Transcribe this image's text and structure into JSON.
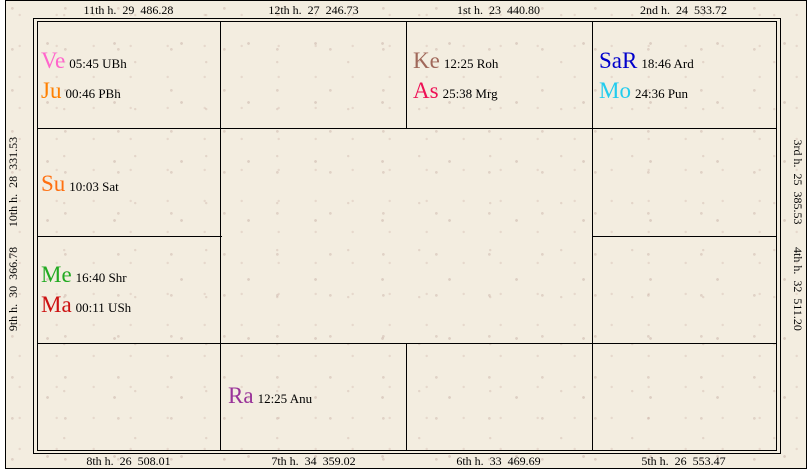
{
  "colors": {
    "Ve": "#ff66cc",
    "Ju": "#ff8000",
    "Ke": "#a0685a",
    "As": "#ee1155",
    "SaR": "#0000cc",
    "Mo": "#22ccee",
    "Su": "#ff7010",
    "Me": "#22aa22",
    "Ma": "#cc1111",
    "Ra": "#993399"
  },
  "houses": {
    "h11": "11th h.  29  486.28",
    "h12": "12th h.  27  246.73",
    "h1": "1st h.  23  440.80",
    "h2": "2nd h.  24  533.72",
    "h10": "10th h.  28  331.53",
    "h9": "9th h.  30  366.78",
    "h3": "3rd h.  25  385.53",
    "h4": "4th h.  32  511.20",
    "h8": "8th h.  26  508.01",
    "h7": "7th h.  34  359.02",
    "h6": "6th h.  33  469.69",
    "h5": "5th h.  26  553.47"
  },
  "planets": {
    "ve": {
      "abbr": "Ve",
      "info": "05:45 UBh"
    },
    "ju": {
      "abbr": "Ju",
      "info": "00:46 PBh"
    },
    "ke": {
      "abbr": "Ke",
      "info": "12:25 Roh"
    },
    "as": {
      "abbr": "As",
      "info": "25:38 Mrg"
    },
    "sar": {
      "abbr": "SaR",
      "info": "18:46 Ard"
    },
    "mo": {
      "abbr": "Mo",
      "info": "24:36 Pun"
    },
    "su": {
      "abbr": "Su",
      "info": "10:03 Sat"
    },
    "me": {
      "abbr": "Me",
      "info": "16:40 Shr"
    },
    "ma": {
      "abbr": "Ma",
      "info": "00:11 USh"
    },
    "ra": {
      "abbr": "Ra",
      "info": "12:25 Anu"
    }
  }
}
